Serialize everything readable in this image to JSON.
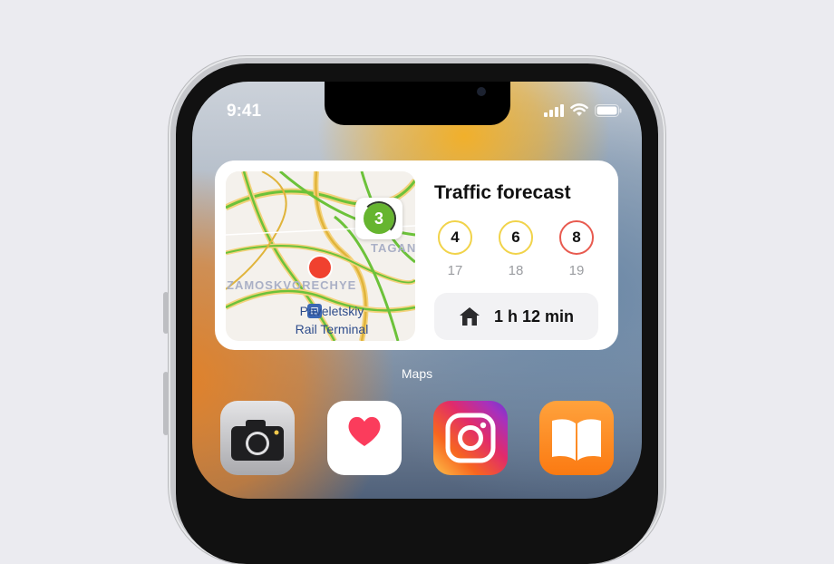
{
  "status_bar": {
    "time": "9:41"
  },
  "widget": {
    "title": "Traffic forecast",
    "score": "3",
    "map": {
      "district_left": "ZAMOSKVORECHYE",
      "district_right": "TAGAN",
      "station_line1": "Paveletskiy",
      "station_line2": "Rail Terminal"
    },
    "forecast": [
      {
        "level": "4",
        "hour": "17",
        "color": "yellow"
      },
      {
        "level": "6",
        "hour": "18",
        "color": "yellow"
      },
      {
        "level": "8",
        "hour": "19",
        "color": "red"
      }
    ],
    "route_time": "1 h 12 min"
  },
  "widget_label": "Maps",
  "dock_apps": [
    {
      "name": "camera-icon"
    },
    {
      "name": "health-icon"
    },
    {
      "name": "instagram-icon"
    },
    {
      "name": "books-icon"
    }
  ],
  "colors": {
    "score_green": "#66b52f",
    "level_yellow": "#f1d34a",
    "level_red": "#e85a4f",
    "location_red": "#f0412f"
  }
}
